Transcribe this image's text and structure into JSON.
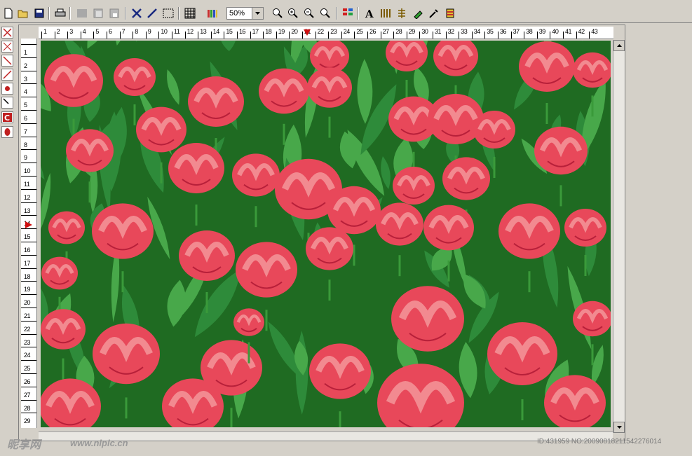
{
  "zoom": {
    "value": "50%"
  },
  "toolbar": {
    "buttons": [
      "new-file",
      "open-folder",
      "save",
      "print",
      "copy",
      "paste",
      "cut",
      "cross-stitch",
      "line-stitch",
      "select",
      "grid",
      "palette",
      "zoom-fit",
      "zoom-in",
      "zoom-out",
      "zoom-actual",
      "color-chart",
      "text",
      "stitch-fill",
      "split",
      "eyedropper",
      "thread"
    ]
  },
  "rulers": {
    "horizontal": [
      "1",
      "2",
      "3",
      "4",
      "5",
      "6",
      "7",
      "8",
      "9",
      "10",
      "11",
      "12",
      "13",
      "14",
      "15",
      "16",
      "17",
      "18",
      "19",
      "20",
      "21",
      "22",
      "23",
      "24",
      "25",
      "26",
      "27",
      "28",
      "29",
      "30",
      "31",
      "32",
      "33",
      "34",
      "35",
      "36",
      "37",
      "38",
      "39",
      "40",
      "41",
      "42",
      "43"
    ],
    "vertical": [
      "1",
      "2",
      "3",
      "4",
      "5",
      "6",
      "7",
      "8",
      "9",
      "10",
      "11",
      "12",
      "13",
      "14",
      "15",
      "16",
      "17",
      "18",
      "19",
      "20",
      "21",
      "22",
      "23",
      "24",
      "25",
      "26",
      "27",
      "28",
      "29"
    ],
    "marker_col": 21,
    "marker_row": 14
  },
  "canvas": {
    "description_colors": {
      "leaf": "#2e8b3a",
      "leaf_dark": "#1a5e22",
      "petal": "#e8485a",
      "petal_light": "#f28a90",
      "petal_dark": "#b8203a"
    }
  },
  "watermark": {
    "logo": "昵享网",
    "url": "www.nipic.cn",
    "id": "ID:431959 NO:20090818211542276014"
  }
}
